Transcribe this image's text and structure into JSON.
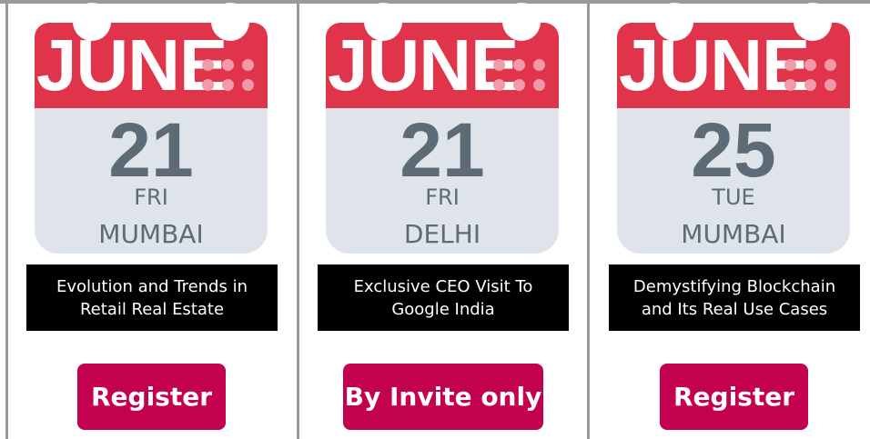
{
  "colors": {
    "calendar_red": "#e0344b",
    "calendar_gray": "#dfe4ea",
    "calendar_text": "#5d6b76",
    "dot_color": "#f29aa7",
    "button": "#c4014f",
    "title_bg": "#000000"
  },
  "events": [
    {
      "month": "JUNE",
      "day": "21",
      "weekday": "FRI",
      "city": "MUMBAI",
      "title": "Evolution and Trends in Retail Real Estate",
      "action": "Register"
    },
    {
      "month": "JUNE",
      "day": "21",
      "weekday": "FRI",
      "city": "DELHI",
      "title": "Exclusive CEO Visit To Google India",
      "action": "By Invite only"
    },
    {
      "month": "JUNE",
      "day": "25",
      "weekday": "TUE",
      "city": "MUMBAI",
      "title": "Demystifying Blockchain and Its Real Use Cases",
      "action": "Register"
    }
  ]
}
